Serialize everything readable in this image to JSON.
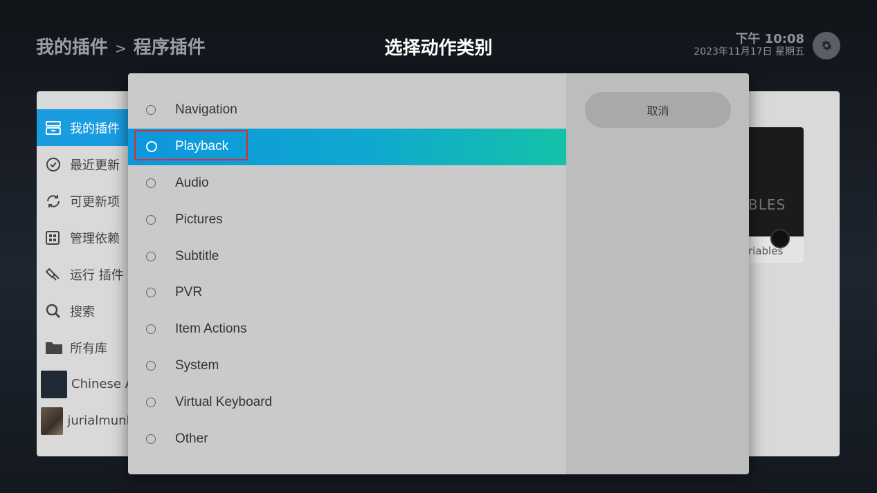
{
  "header": {
    "breadcrumb_root": "我的插件",
    "breadcrumb_sep": ">",
    "breadcrumb_current": "程序插件",
    "title": "选择动作类别",
    "time": "下午 10:08",
    "date": "2023年11月17日 星期五"
  },
  "sidebar": {
    "items": [
      {
        "label": "我的插件",
        "icon": "box-icon",
        "active": true
      },
      {
        "label": "最近更新",
        "icon": "history-icon"
      },
      {
        "label": "可更新项",
        "icon": "refresh-icon"
      },
      {
        "label": "管理依赖",
        "icon": "grid-icon"
      },
      {
        "label": "运行 插件",
        "icon": "plugin-icon"
      },
      {
        "label": "搜索",
        "icon": "search-icon"
      },
      {
        "label": "所有库",
        "icon": "folder-icon"
      },
      {
        "label": "Chinese A",
        "icon": "kodi-thumb"
      },
      {
        "label": "jurialmunk",
        "icon": "avatar-thumb"
      }
    ]
  },
  "card": {
    "image_text": "BLES",
    "label": "riables"
  },
  "dialog": {
    "options": [
      "Navigation",
      "Playback",
      "Audio",
      "Pictures",
      "Subtitle",
      "PVR",
      "Item Actions",
      "System",
      "Virtual Keyboard",
      "Other"
    ],
    "focused_index": 1,
    "cancel_label": "取消"
  },
  "colors": {
    "focus_start": "#0d96de",
    "focus_end": "#14c2a8",
    "highlight_box": "#e12b2b",
    "sidebar_active": "#1a9de0"
  }
}
